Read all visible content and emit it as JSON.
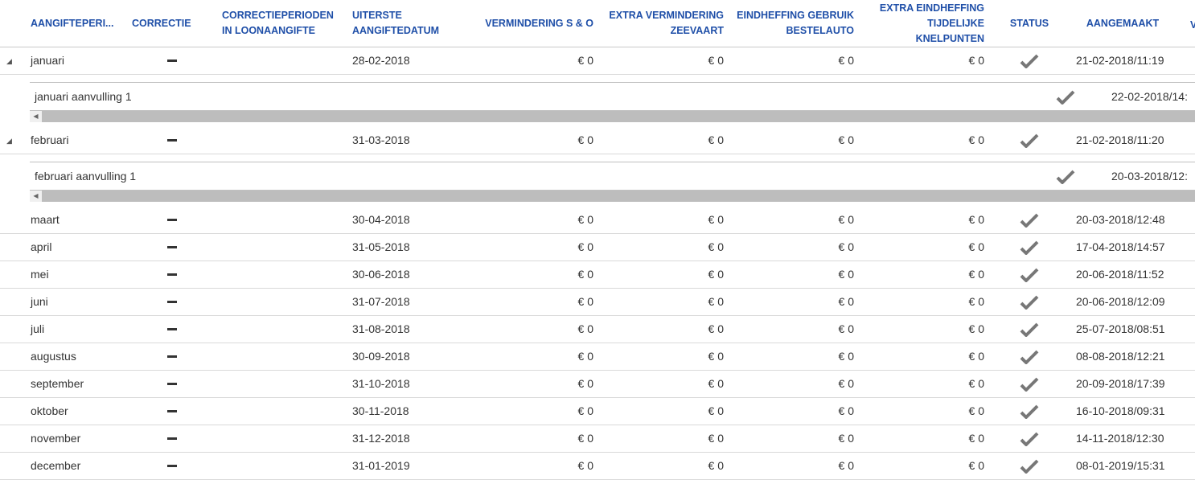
{
  "columns": {
    "period": "AANGIFTEPERI...",
    "correctie": "CORRECTIE",
    "correctieperioden": "CORRECTIEPERIODEN IN LOONAANGIFTE",
    "uiterste": "UITERSTE AANGIFTEDATUM",
    "vermindering": "VERMINDERING S & O",
    "zeevaart": "EXTRA VERMINDERING ZEEVAART",
    "bestelauto": "EINDHEFFING GEBRUIK BESTELAUTO",
    "knelpunten": "EXTRA EINDHEFFING TIJDELIJKE KNELPUNTEN",
    "status": "STATUS",
    "aangemaakt": "AANGEMAAKT",
    "extra": "V"
  },
  "rows": [
    {
      "period": "januari",
      "uiterste": "28-02-2018",
      "vermindering": "€ 0",
      "zeevaart": "€ 0",
      "bestelauto": "€ 0",
      "knelpunten": "€ 0",
      "aangemaakt": "21-02-2018/11:19",
      "expanded": true,
      "sub": {
        "label": "januari aanvulling 1",
        "aangemaakt": "22-02-2018/14:"
      }
    },
    {
      "period": "februari",
      "uiterste": "31-03-2018",
      "vermindering": "€ 0",
      "zeevaart": "€ 0",
      "bestelauto": "€ 0",
      "knelpunten": "€ 0",
      "aangemaakt": "21-02-2018/11:20",
      "expanded": true,
      "sub": {
        "label": "februari aanvulling 1",
        "aangemaakt": "20-03-2018/12:"
      }
    },
    {
      "period": "maart",
      "uiterste": "30-04-2018",
      "vermindering": "€ 0",
      "zeevaart": "€ 0",
      "bestelauto": "€ 0",
      "knelpunten": "€ 0",
      "aangemaakt": "20-03-2018/12:48"
    },
    {
      "period": "april",
      "uiterste": "31-05-2018",
      "vermindering": "€ 0",
      "zeevaart": "€ 0",
      "bestelauto": "€ 0",
      "knelpunten": "€ 0",
      "aangemaakt": "17-04-2018/14:57"
    },
    {
      "period": "mei",
      "uiterste": "30-06-2018",
      "vermindering": "€ 0",
      "zeevaart": "€ 0",
      "bestelauto": "€ 0",
      "knelpunten": "€ 0",
      "aangemaakt": "20-06-2018/11:52"
    },
    {
      "period": "juni",
      "uiterste": "31-07-2018",
      "vermindering": "€ 0",
      "zeevaart": "€ 0",
      "bestelauto": "€ 0",
      "knelpunten": "€ 0",
      "aangemaakt": "20-06-2018/12:09"
    },
    {
      "period": "juli",
      "uiterste": "31-08-2018",
      "vermindering": "€ 0",
      "zeevaart": "€ 0",
      "bestelauto": "€ 0",
      "knelpunten": "€ 0",
      "aangemaakt": "25-07-2018/08:51"
    },
    {
      "period": "augustus",
      "uiterste": "30-09-2018",
      "vermindering": "€ 0",
      "zeevaart": "€ 0",
      "bestelauto": "€ 0",
      "knelpunten": "€ 0",
      "aangemaakt": "08-08-2018/12:21"
    },
    {
      "period": "september",
      "uiterste": "31-10-2018",
      "vermindering": "€ 0",
      "zeevaart": "€ 0",
      "bestelauto": "€ 0",
      "knelpunten": "€ 0",
      "aangemaakt": "20-09-2018/17:39"
    },
    {
      "period": "oktober",
      "uiterste": "30-11-2018",
      "vermindering": "€ 0",
      "zeevaart": "€ 0",
      "bestelauto": "€ 0",
      "knelpunten": "€ 0",
      "aangemaakt": "16-10-2018/09:31"
    },
    {
      "period": "november",
      "uiterste": "31-12-2018",
      "vermindering": "€ 0",
      "zeevaart": "€ 0",
      "bestelauto": "€ 0",
      "knelpunten": "€ 0",
      "aangemaakt": "14-11-2018/12:30"
    },
    {
      "period": "december",
      "uiterste": "31-01-2019",
      "vermindering": "€ 0",
      "zeevaart": "€ 0",
      "bestelauto": "€ 0",
      "knelpunten": "€ 0",
      "aangemaakt": "08-01-2019/15:31"
    }
  ],
  "icons": {
    "correctie": "dash-icon",
    "status": "checkmark-icon",
    "expand": "collapse-triangle-icon",
    "scroll": "scroll-left-arrow-icon"
  },
  "colors": {
    "header_text": "#1f4fa8",
    "check": "#777777",
    "scrollbar": "#bdbdbd"
  }
}
